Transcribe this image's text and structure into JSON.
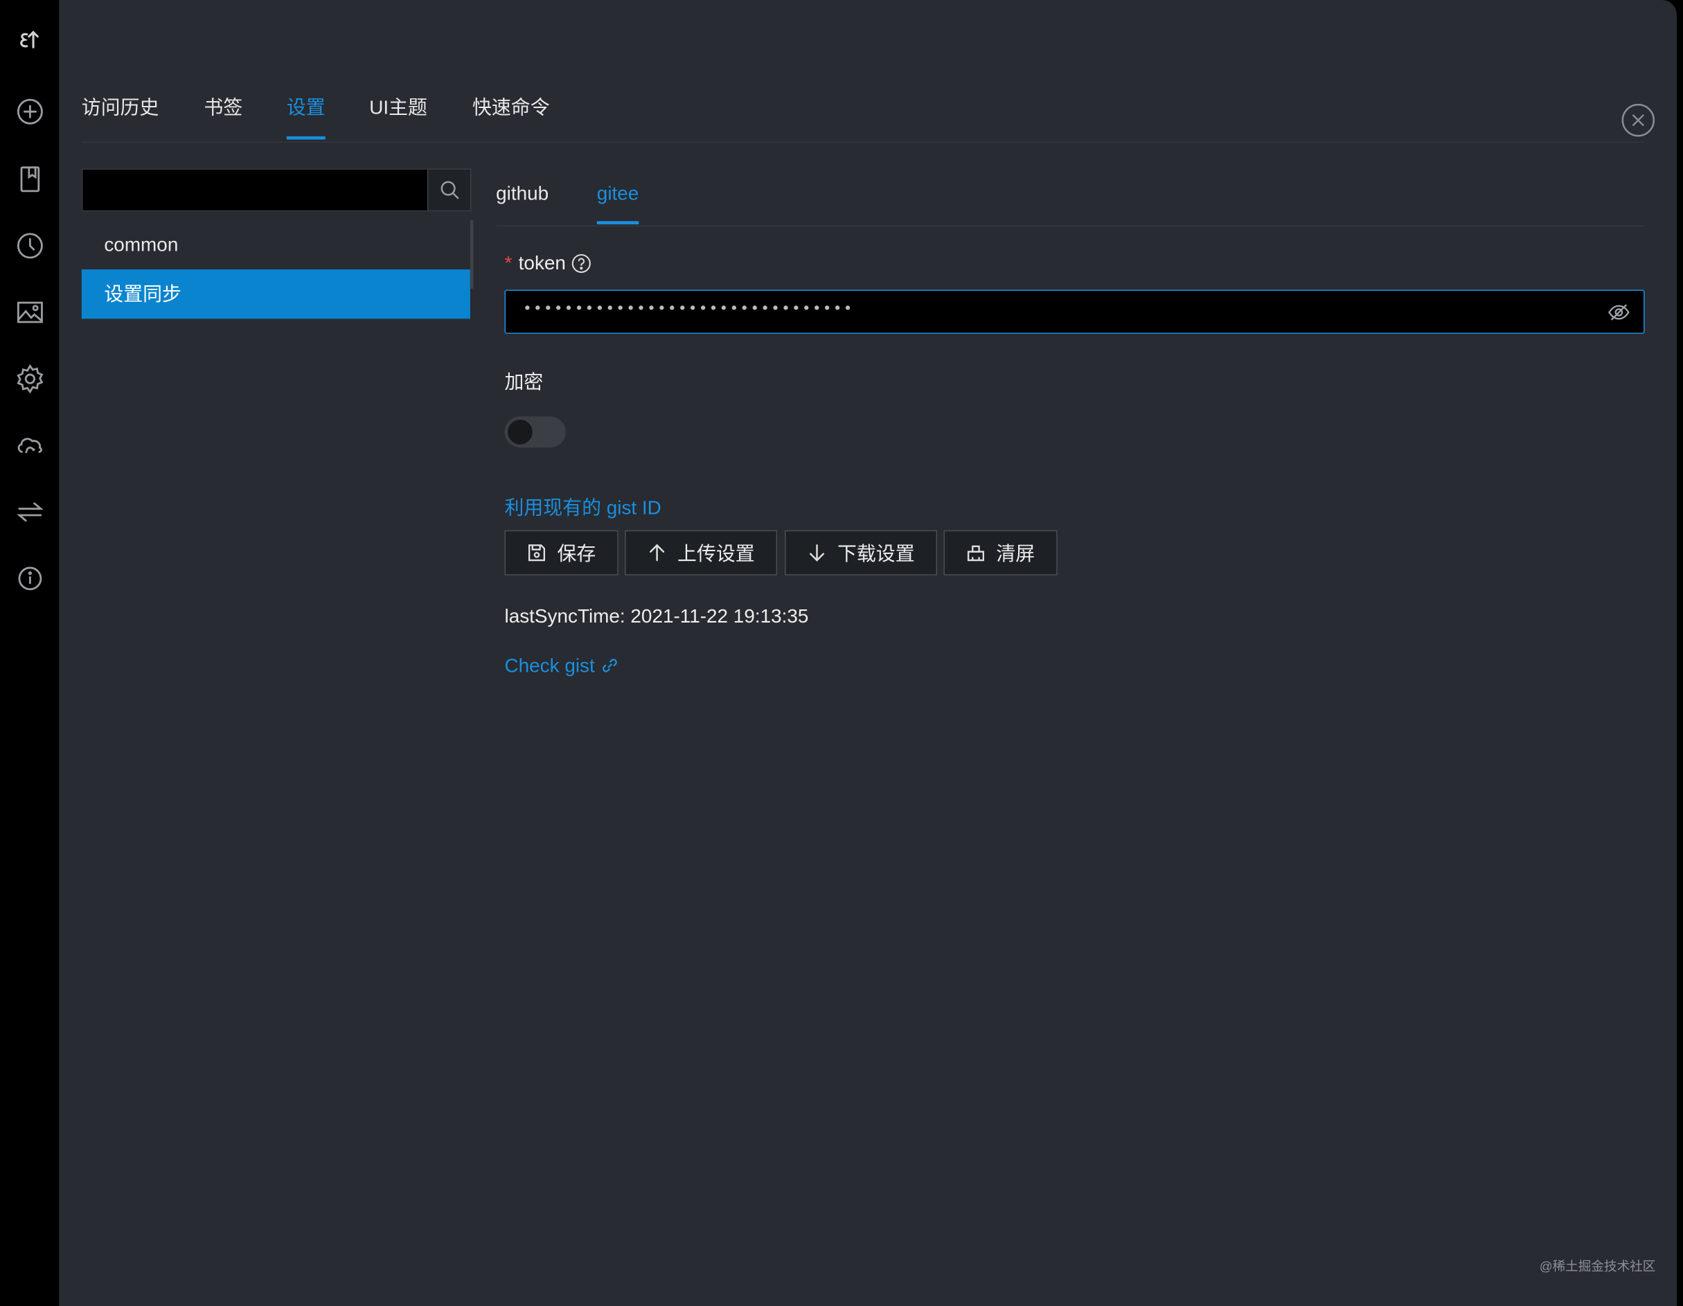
{
  "activity_bar": {
    "logo_text": "ɛↀ",
    "icons": [
      "logo-icon",
      "add-circle-icon",
      "bookmark-icon",
      "clock-icon",
      "image-icon",
      "gear-icon",
      "cloud-sync-icon",
      "transfer-icon",
      "info-icon"
    ]
  },
  "main_tabs": [
    {
      "label": "访问历史",
      "active": false
    },
    {
      "label": "书签",
      "active": false
    },
    {
      "label": "设置",
      "active": true
    },
    {
      "label": "UI主题",
      "active": false
    },
    {
      "label": "快速命令",
      "active": false
    }
  ],
  "search": {
    "placeholder": "",
    "value": ""
  },
  "sidebar": {
    "items": [
      {
        "label": "common",
        "active": false
      },
      {
        "label": "设置同步",
        "active": true
      }
    ]
  },
  "sub_tabs": [
    {
      "label": "github",
      "active": false
    },
    {
      "label": "gitee",
      "active": true
    }
  ],
  "form": {
    "required_mark": "*",
    "token_label": "token",
    "token_value": "••••••••••••••••••••••••••••••••",
    "encrypt_label": "加密",
    "encrypt_enabled": false,
    "gist_link": "利用现有的 gist ID"
  },
  "actions": {
    "save": "保存",
    "upload": "上传设置",
    "download": "下载设置",
    "clear": "清屏"
  },
  "sync": {
    "last_sync_time": "lastSyncTime: 2021-11-22 19:13:35",
    "check_gist": "Check gist"
  },
  "watermark": "@稀土掘金技术社区",
  "colors": {
    "accent": "#1a8fe0",
    "panel": "#282b31",
    "sidebar_active": "#0a84cf",
    "required": "#e5484d"
  }
}
